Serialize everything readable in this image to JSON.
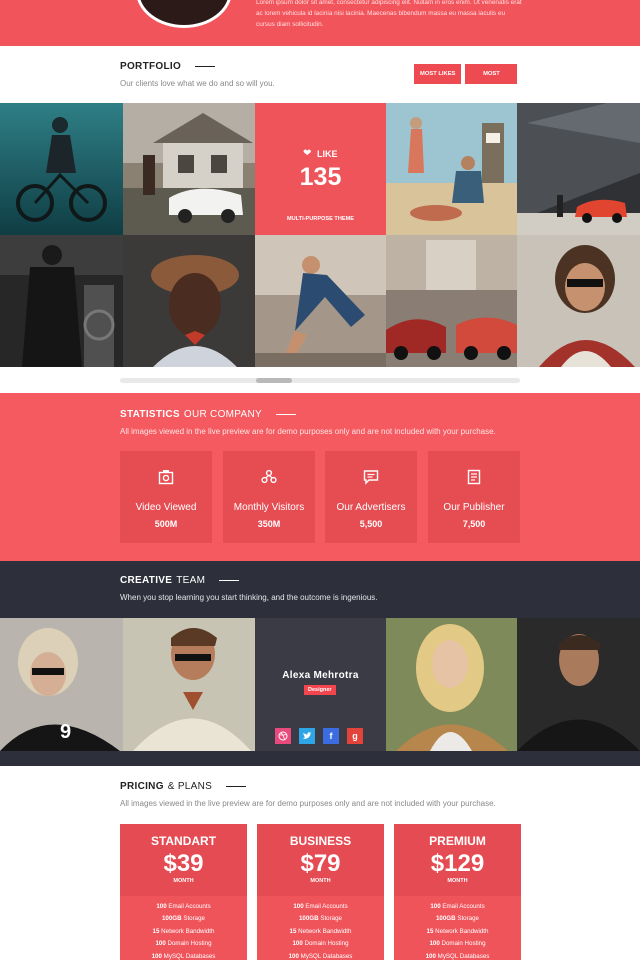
{
  "top": {
    "text": "Lorem ipsum dolor sit amet, consectetur adipiscing elit. Nullam in eros enim. Ut venenatis erat ac lorem vehicula id lacinia nisi lacinia. Maecenas bibendum massa eu massa iaculis eu cursus diam sollicitudin."
  },
  "portfolio": {
    "title": "Portfolio",
    "subtitle": "Our clients love what we do and so will you.",
    "buttons": [
      "Most Likes",
      "Most Recent"
    ],
    "like_label": "LIKE",
    "like_count": "135",
    "like_theme": "Multi-Purpose Theme",
    "tiles_top": [
      "cyclist-photo",
      "house-car-photo",
      "like-tile",
      "beach-photo",
      "red-car-photo"
    ],
    "tiles_bottom": [
      "gym-photo",
      "portrait-hat-photo",
      "runner-photo",
      "street-cars-photo",
      "sunglasses-man-photo"
    ]
  },
  "statistics": {
    "title": "Statistics",
    "title_light": "Our Company",
    "subtitle": "All images viewed in the live preview are for demo purposes only and are not included with your purchase.",
    "items": [
      {
        "icon": "camera-icon",
        "label": "Video Viewed",
        "value": "500M"
      },
      {
        "icon": "visitors-icon",
        "label": "Monthly Visitors",
        "value": "350M"
      },
      {
        "icon": "chat-icon",
        "label": "Our Advertisers",
        "value": "5,500"
      },
      {
        "icon": "document-icon",
        "label": "Our Publisher",
        "value": "7,500"
      }
    ]
  },
  "team": {
    "title": "Creative",
    "title_light": "Team",
    "subtitle": "When you stop learning you start thinking, and the outcome is ingenious.",
    "featured": {
      "name": "Alexa Mehrotra",
      "role": "Designer"
    },
    "socials": [
      "dribbble-icon",
      "twitter-icon",
      "facebook-icon",
      "google-icon"
    ]
  },
  "pricing": {
    "title": "Pricing",
    "title_light": "& Plans",
    "subtitle": "All images viewed in the live preview are for demo purposes only and are not included with your purchase.",
    "plans": [
      {
        "name": "Standart",
        "price": "$39",
        "period": "MONTH",
        "features": [
          [
            "100",
            "Email Accounts"
          ],
          [
            "100GB",
            "Storage"
          ],
          [
            "15",
            "Network Bandwidth"
          ],
          [
            "100",
            "Domain Hosting"
          ],
          [
            "100",
            "MySQL Databases"
          ]
        ]
      },
      {
        "name": "Business",
        "price": "$79",
        "period": "MONTH",
        "features": [
          [
            "100",
            "Email Accounts"
          ],
          [
            "100GB",
            "Storage"
          ],
          [
            "15",
            "Network Bandwidth"
          ],
          [
            "100",
            "Domain Hosting"
          ],
          [
            "100",
            "MySQL Databases"
          ]
        ]
      },
      {
        "name": "Premium",
        "price": "$129",
        "period": "MONTH",
        "features": [
          [
            "100",
            "Email Accounts"
          ],
          [
            "100GB",
            "Storage"
          ],
          [
            "15",
            "Network Bandwidth"
          ],
          [
            "100",
            "Domain Hosting"
          ],
          [
            "100",
            "MySQL Databases"
          ]
        ]
      }
    ]
  },
  "colors": {
    "accent": "#f2545b",
    "accent_dark": "#e54b52",
    "team_bg": "#2d2f3a"
  }
}
